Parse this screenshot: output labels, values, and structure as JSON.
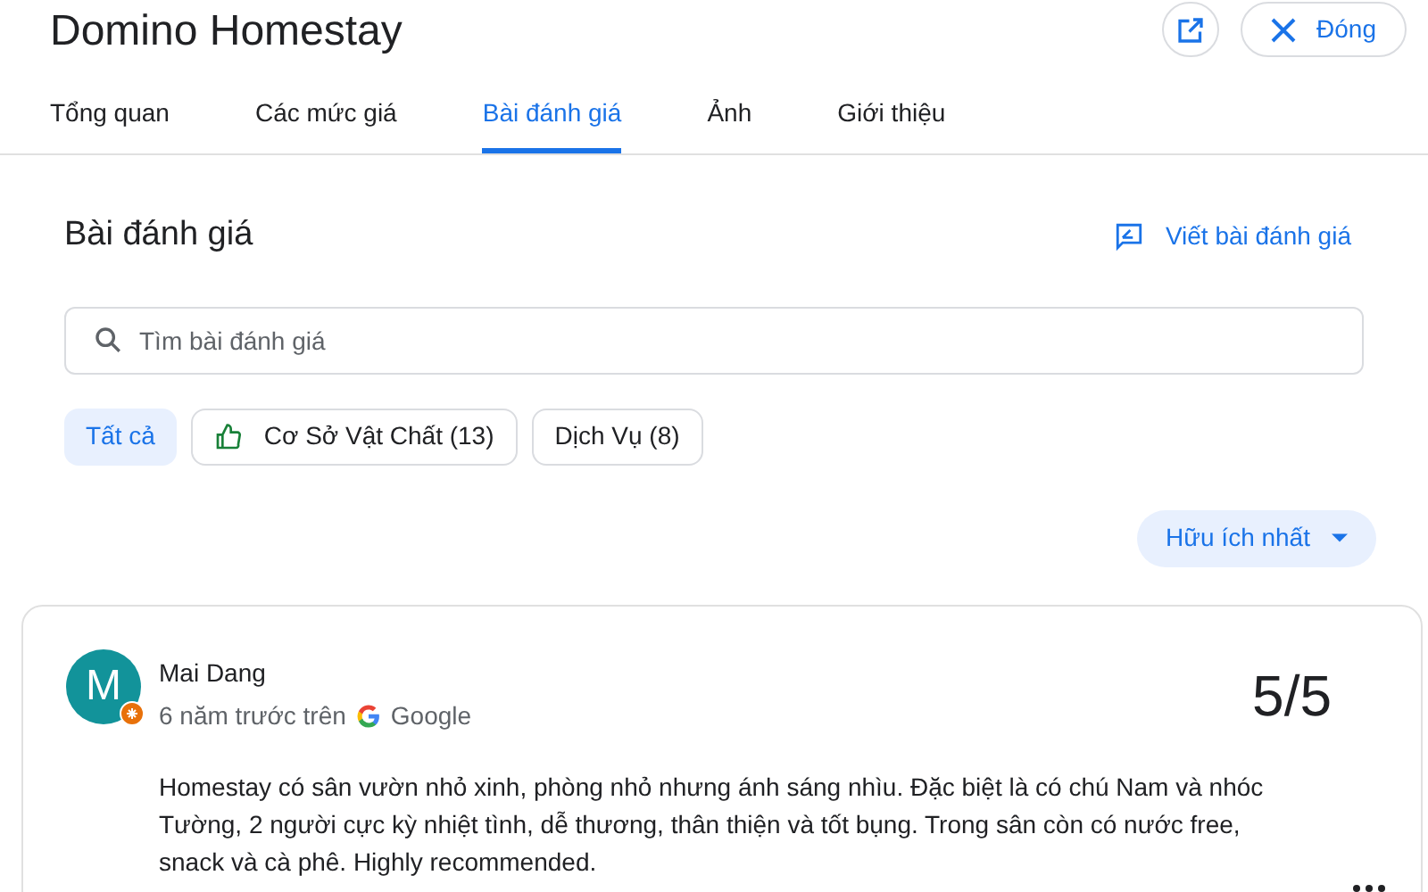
{
  "header": {
    "title": "Domino Homestay",
    "close_label": "Đóng"
  },
  "tabs": [
    {
      "label": "Tổng quan",
      "selected": false
    },
    {
      "label": "Các mức giá",
      "selected": false
    },
    {
      "label": "Bài đánh giá",
      "selected": true
    },
    {
      "label": "Ảnh",
      "selected": false
    },
    {
      "label": "Giới thiệu",
      "selected": false
    }
  ],
  "reviews": {
    "heading": "Bài đánh giá",
    "write_label": "Viết bài đánh giá",
    "search": {
      "placeholder": "Tìm bài đánh giá"
    },
    "filters": [
      {
        "label": "Tất cả",
        "selected": true,
        "kind": "plain"
      },
      {
        "label": "Cơ Sở Vật Chất (13)",
        "selected": false,
        "kind": "thumbs"
      },
      {
        "label": "Dịch Vụ (8)",
        "selected": false,
        "kind": "plain"
      }
    ],
    "sort": "Hữu ích nhất",
    "items": [
      {
        "initial": "M",
        "author": "Mai Dang",
        "meta": "6 năm trước trên",
        "source": "Google",
        "score": "5/5",
        "text": "Homestay có sân vườn nhỏ xinh, phòng nhỏ nhưng ánh sáng nhìu. Đặc biệt là có chú Nam và nhóc Tường, 2 người cực kỳ nhiệt tình, dễ thương, thân thiện và tốt bụng. Trong sân còn có nước free, snack và cà phê. Highly recommended."
      }
    ]
  }
}
